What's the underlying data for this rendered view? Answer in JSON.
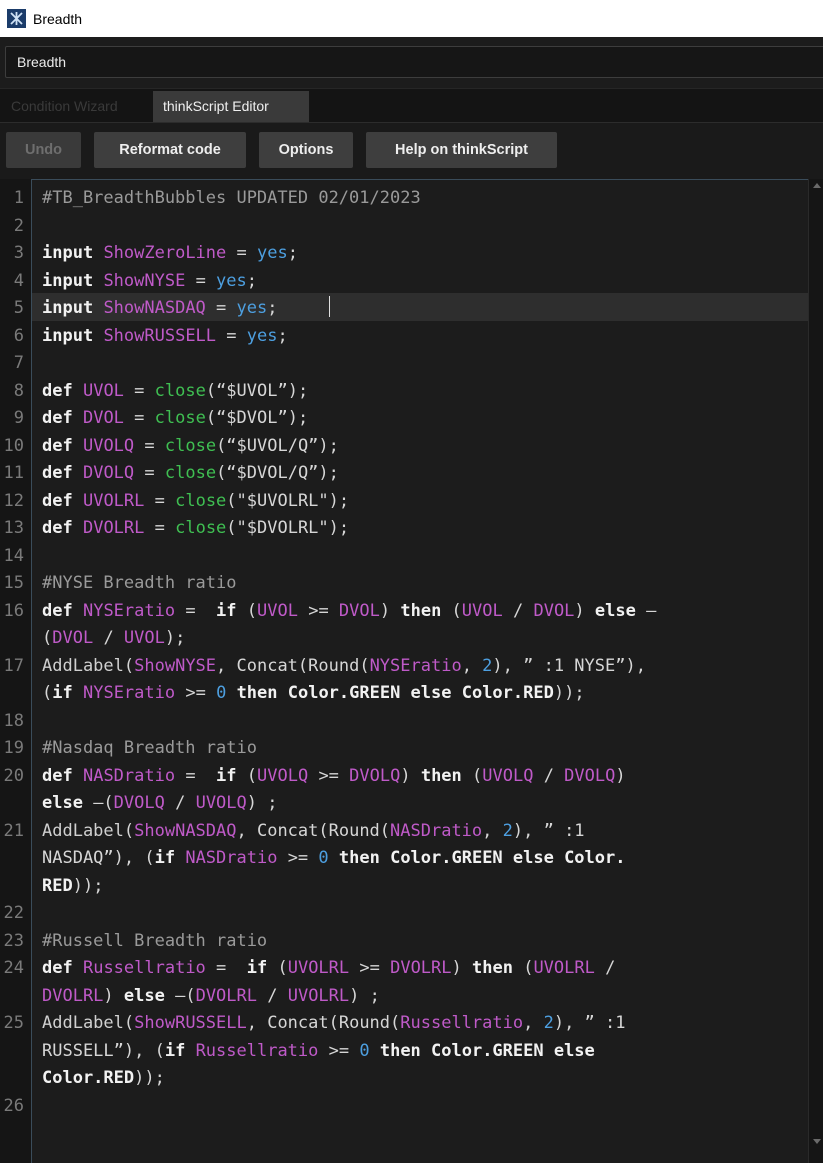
{
  "window": {
    "title": "Breadth"
  },
  "study_name": {
    "value": "Breadth"
  },
  "tabs": [
    {
      "label": "Condition Wizard"
    },
    {
      "label": "thinkScript Editor"
    }
  ],
  "toolbar": {
    "undo": "Undo",
    "reformat": "Reformat code",
    "options": "Options",
    "help": "Help on thinkScript"
  },
  "editor": {
    "line_numbers": [
      "1",
      "2",
      "3",
      "4",
      "5",
      "6",
      "7",
      "8",
      "9",
      "10",
      "11",
      "12",
      "13",
      "14",
      "15",
      "16",
      "",
      "17",
      "",
      "18",
      "19",
      "20",
      "",
      "21",
      "",
      "",
      "22",
      "23",
      "24",
      "",
      "25",
      "",
      "",
      "26"
    ],
    "lines": [
      [
        {
          "t": "#TB_BreadthBubbles UPDATED 02/01/2023",
          "c": "cmt"
        }
      ],
      [],
      [
        {
          "t": "input",
          "c": "kw"
        },
        {
          "t": " "
        },
        {
          "t": "ShowZeroLine",
          "c": "var"
        },
        {
          "t": " = "
        },
        {
          "t": "yes",
          "c": "val"
        },
        {
          "t": ";"
        }
      ],
      [
        {
          "t": "input",
          "c": "kw"
        },
        {
          "t": " "
        },
        {
          "t": "ShowNYSE",
          "c": "var"
        },
        {
          "t": " = "
        },
        {
          "t": "yes",
          "c": "val"
        },
        {
          "t": ";"
        }
      ],
      [
        {
          "t": "input",
          "c": "kw"
        },
        {
          "t": " "
        },
        {
          "t": "ShowNASDAQ",
          "c": "var"
        },
        {
          "t": " = "
        },
        {
          "t": "yes",
          "c": "val"
        },
        {
          "t": ";"
        }
      ],
      [
        {
          "t": "input",
          "c": "kw"
        },
        {
          "t": " "
        },
        {
          "t": "ShowRUSSELL",
          "c": "var"
        },
        {
          "t": " = "
        },
        {
          "t": "yes",
          "c": "val"
        },
        {
          "t": ";"
        }
      ],
      [],
      [
        {
          "t": "def",
          "c": "kw"
        },
        {
          "t": " "
        },
        {
          "t": "UVOL",
          "c": "var"
        },
        {
          "t": " = "
        },
        {
          "t": "close",
          "c": "fn"
        },
        {
          "t": "(“$UVOL”);"
        }
      ],
      [
        {
          "t": "def",
          "c": "kw"
        },
        {
          "t": " "
        },
        {
          "t": "DVOL",
          "c": "var"
        },
        {
          "t": " = "
        },
        {
          "t": "close",
          "c": "fn"
        },
        {
          "t": "(“$DVOL”);"
        }
      ],
      [
        {
          "t": "def",
          "c": "kw"
        },
        {
          "t": " "
        },
        {
          "t": "UVOLQ",
          "c": "var"
        },
        {
          "t": " = "
        },
        {
          "t": "close",
          "c": "fn"
        },
        {
          "t": "(“$UVOL/Q”);"
        }
      ],
      [
        {
          "t": "def",
          "c": "kw"
        },
        {
          "t": " "
        },
        {
          "t": "DVOLQ",
          "c": "var"
        },
        {
          "t": " = "
        },
        {
          "t": "close",
          "c": "fn"
        },
        {
          "t": "(“$DVOL/Q”);"
        }
      ],
      [
        {
          "t": "def",
          "c": "kw"
        },
        {
          "t": " "
        },
        {
          "t": "UVOLRL",
          "c": "var"
        },
        {
          "t": " = "
        },
        {
          "t": "close",
          "c": "fn"
        },
        {
          "t": "(\"$UVOLRL\");"
        }
      ],
      [
        {
          "t": "def",
          "c": "kw"
        },
        {
          "t": " "
        },
        {
          "t": "DVOLRL",
          "c": "var"
        },
        {
          "t": " = "
        },
        {
          "t": "close",
          "c": "fn"
        },
        {
          "t": "(\"$DVOLRL\");"
        }
      ],
      [],
      [
        {
          "t": "#NYSE Breadth ratio",
          "c": "cmt"
        }
      ],
      [
        {
          "t": "def",
          "c": "kw"
        },
        {
          "t": " "
        },
        {
          "t": "NYSEratio",
          "c": "var"
        },
        {
          "t": " =  "
        },
        {
          "t": "if",
          "c": "kw"
        },
        {
          "t": " ("
        },
        {
          "t": "UVOL",
          "c": "var"
        },
        {
          "t": " >= "
        },
        {
          "t": "DVOL",
          "c": "var"
        },
        {
          "t": ") "
        },
        {
          "t": "then",
          "c": "kw"
        },
        {
          "t": " ("
        },
        {
          "t": "UVOL",
          "c": "var"
        },
        {
          "t": " / "
        },
        {
          "t": "DVOL",
          "c": "var"
        },
        {
          "t": ") "
        },
        {
          "t": "else",
          "c": "kw"
        },
        {
          "t": " –"
        }
      ],
      [
        {
          "t": "("
        },
        {
          "t": "DVOL",
          "c": "var"
        },
        {
          "t": " / "
        },
        {
          "t": "UVOL",
          "c": "var"
        },
        {
          "t": ");"
        }
      ],
      [
        {
          "t": "AddLabel",
          "c": "fn2"
        },
        {
          "t": "("
        },
        {
          "t": "ShowNYSE",
          "c": "var"
        },
        {
          "t": ", Concat(Round("
        },
        {
          "t": "NYSEratio",
          "c": "var"
        },
        {
          "t": ", "
        },
        {
          "t": "2",
          "c": "val"
        },
        {
          "t": "), ” :1 NYSE”),"
        }
      ],
      [
        {
          "t": "("
        },
        {
          "t": "if",
          "c": "kw"
        },
        {
          "t": " "
        },
        {
          "t": "NYSEratio",
          "c": "var"
        },
        {
          "t": " >= "
        },
        {
          "t": "0",
          "c": "val"
        },
        {
          "t": " "
        },
        {
          "t": "then Color.GREEN else Color.RED",
          "c": "kw"
        },
        {
          "t": "));"
        }
      ],
      [],
      [
        {
          "t": "#Nasdaq Breadth ratio",
          "c": "cmt"
        }
      ],
      [
        {
          "t": "def",
          "c": "kw"
        },
        {
          "t": " "
        },
        {
          "t": "NASDratio",
          "c": "var"
        },
        {
          "t": " =  "
        },
        {
          "t": "if",
          "c": "kw"
        },
        {
          "t": " ("
        },
        {
          "t": "UVOLQ",
          "c": "var"
        },
        {
          "t": " >= "
        },
        {
          "t": "DVOLQ",
          "c": "var"
        },
        {
          "t": ") "
        },
        {
          "t": "then",
          "c": "kw"
        },
        {
          "t": " ("
        },
        {
          "t": "UVOLQ",
          "c": "var"
        },
        {
          "t": " / "
        },
        {
          "t": "DVOLQ",
          "c": "var"
        },
        {
          "t": ")"
        }
      ],
      [
        {
          "t": "else",
          "c": "kw"
        },
        {
          "t": " –("
        },
        {
          "t": "DVOLQ",
          "c": "var"
        },
        {
          "t": " / "
        },
        {
          "t": "UVOLQ",
          "c": "var"
        },
        {
          "t": ") ;"
        }
      ],
      [
        {
          "t": "AddLabel",
          "c": "fn2"
        },
        {
          "t": "("
        },
        {
          "t": "ShowNASDAQ",
          "c": "var"
        },
        {
          "t": ", Concat(Round("
        },
        {
          "t": "NASDratio",
          "c": "var"
        },
        {
          "t": ", "
        },
        {
          "t": "2",
          "c": "val"
        },
        {
          "t": "), ” :1"
        }
      ],
      [
        {
          "t": "NASDAQ”), ("
        },
        {
          "t": "if",
          "c": "kw"
        },
        {
          "t": " "
        },
        {
          "t": "NASDratio",
          "c": "var"
        },
        {
          "t": " >= "
        },
        {
          "t": "0",
          "c": "val"
        },
        {
          "t": " "
        },
        {
          "t": "then Color.GREEN else Color.",
          "c": "kw"
        }
      ],
      [
        {
          "t": "RED",
          "c": "kw"
        },
        {
          "t": "));"
        }
      ],
      [],
      [
        {
          "t": "#Russell Breadth ratio",
          "c": "cmt"
        }
      ],
      [
        {
          "t": "def",
          "c": "kw"
        },
        {
          "t": " "
        },
        {
          "t": "Russellratio",
          "c": "var"
        },
        {
          "t": " =  "
        },
        {
          "t": "if",
          "c": "kw"
        },
        {
          "t": " ("
        },
        {
          "t": "UVOLRL",
          "c": "var"
        },
        {
          "t": " >= "
        },
        {
          "t": "DVOLRL",
          "c": "var"
        },
        {
          "t": ") "
        },
        {
          "t": "then",
          "c": "kw"
        },
        {
          "t": " ("
        },
        {
          "t": "UVOLRL",
          "c": "var"
        },
        {
          "t": " /"
        }
      ],
      [
        {
          "t": "DVOLRL",
          "c": "var"
        },
        {
          "t": ") "
        },
        {
          "t": "else",
          "c": "kw"
        },
        {
          "t": " –("
        },
        {
          "t": "DVOLRL",
          "c": "var"
        },
        {
          "t": " / "
        },
        {
          "t": "UVOLRL",
          "c": "var"
        },
        {
          "t": ") ;"
        }
      ],
      [
        {
          "t": "AddLabel",
          "c": "fn2"
        },
        {
          "t": "("
        },
        {
          "t": "ShowRUSSELL",
          "c": "var"
        },
        {
          "t": ", Concat(Round("
        },
        {
          "t": "Russellratio",
          "c": "var"
        },
        {
          "t": ", "
        },
        {
          "t": "2",
          "c": "val"
        },
        {
          "t": "), ” :1"
        }
      ],
      [
        {
          "t": "RUSSELL”), ("
        },
        {
          "t": "if",
          "c": "kw"
        },
        {
          "t": " "
        },
        {
          "t": "Russellratio",
          "c": "var"
        },
        {
          "t": " >= "
        },
        {
          "t": "0",
          "c": "val"
        },
        {
          "t": " "
        },
        {
          "t": "then Color.GREEN else",
          "c": "kw"
        }
      ],
      [
        {
          "t": "Color.RED",
          "c": "kw"
        },
        {
          "t": "));"
        }
      ],
      []
    ]
  }
}
